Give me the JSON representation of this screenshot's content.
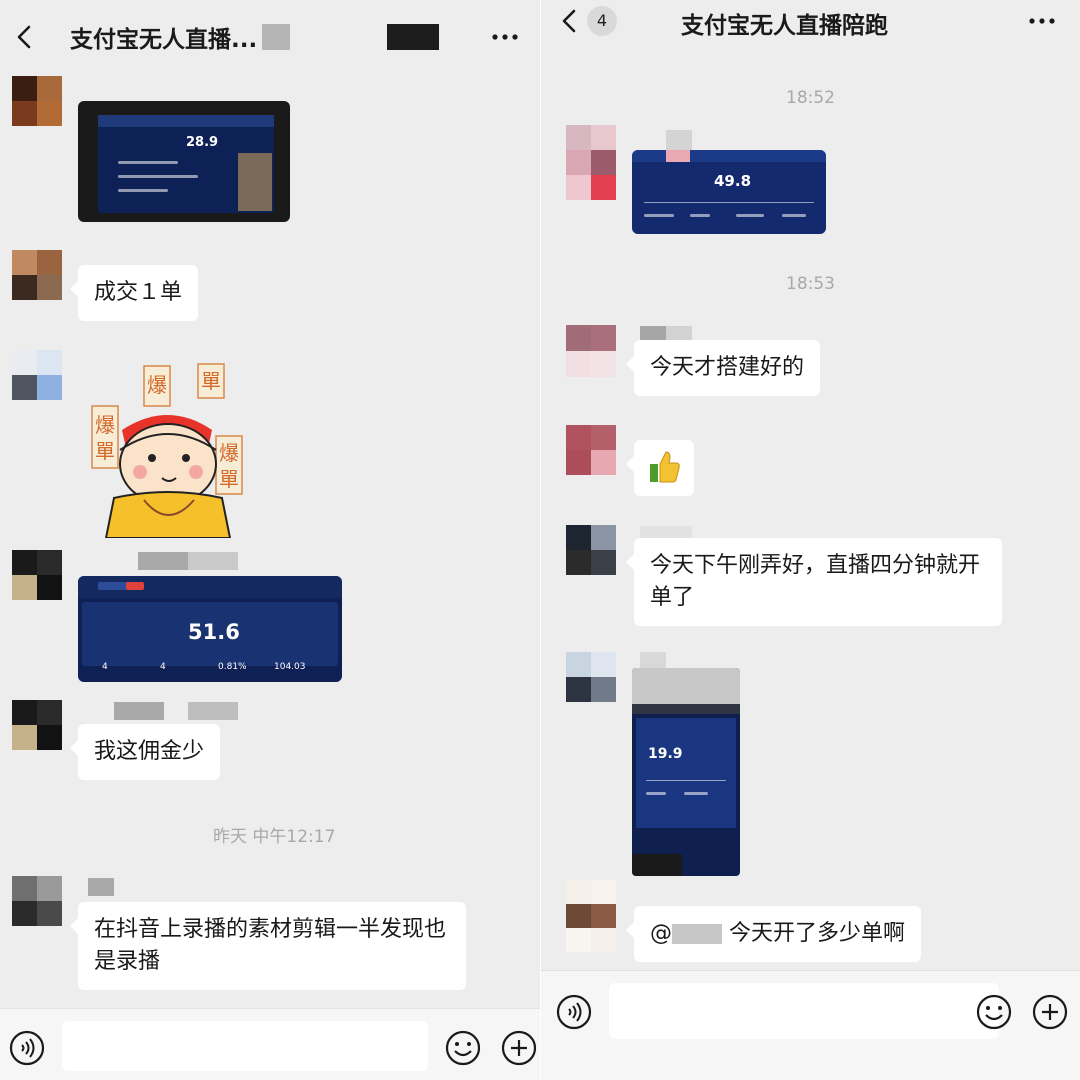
{
  "left": {
    "header": {
      "title": "支付宝无人直播...",
      "more_label": "···"
    },
    "messages": [
      {
        "type": "image",
        "description_value": "28.9"
      },
      {
        "type": "text",
        "text": "成交１单"
      },
      {
        "type": "sticker",
        "sticker_text": [
          "爆",
          "單",
          "爆",
          "單",
          "爆",
          "單"
        ]
      },
      {
        "type": "image",
        "big_value": "51.6",
        "stats": [
          "4",
          "4",
          "0.81%",
          "104.03"
        ]
      },
      {
        "type": "text",
        "text": "我这佣金少"
      },
      {
        "type": "time",
        "text": "昨天 中午12:17"
      },
      {
        "type": "text",
        "text": "在抖音上录播的素材剪辑一半发现也是录播"
      }
    ],
    "input": {
      "placeholder": ""
    }
  },
  "right": {
    "header": {
      "title": "支付宝无人直播陪跑",
      "unread": "4",
      "more_label": "···"
    },
    "messages": [
      {
        "type": "time",
        "text": "18:52"
      },
      {
        "type": "image",
        "big_value": "49.8"
      },
      {
        "type": "time",
        "text": "18:53"
      },
      {
        "type": "text",
        "text": "今天才搭建好的"
      },
      {
        "type": "emoji",
        "name": "thumbs-up"
      },
      {
        "type": "text",
        "text": "今天下午刚弄好，直播四分钟就开单了"
      },
      {
        "type": "image",
        "big_value": "19.9"
      },
      {
        "type": "text",
        "text_prefix": "@",
        "text": "今天开了多少单啊"
      }
    ],
    "input": {
      "placeholder": ""
    }
  },
  "colors": {
    "chat_bg": "#ededed",
    "bubble": "#ffffff",
    "dashboard_bg": "#0d1c4a",
    "timestamp": "#a8a8a8"
  },
  "icons": [
    "back-icon",
    "more-icon",
    "voice-icon",
    "emoji-icon",
    "plus-icon",
    "thumbs-up-icon"
  ]
}
